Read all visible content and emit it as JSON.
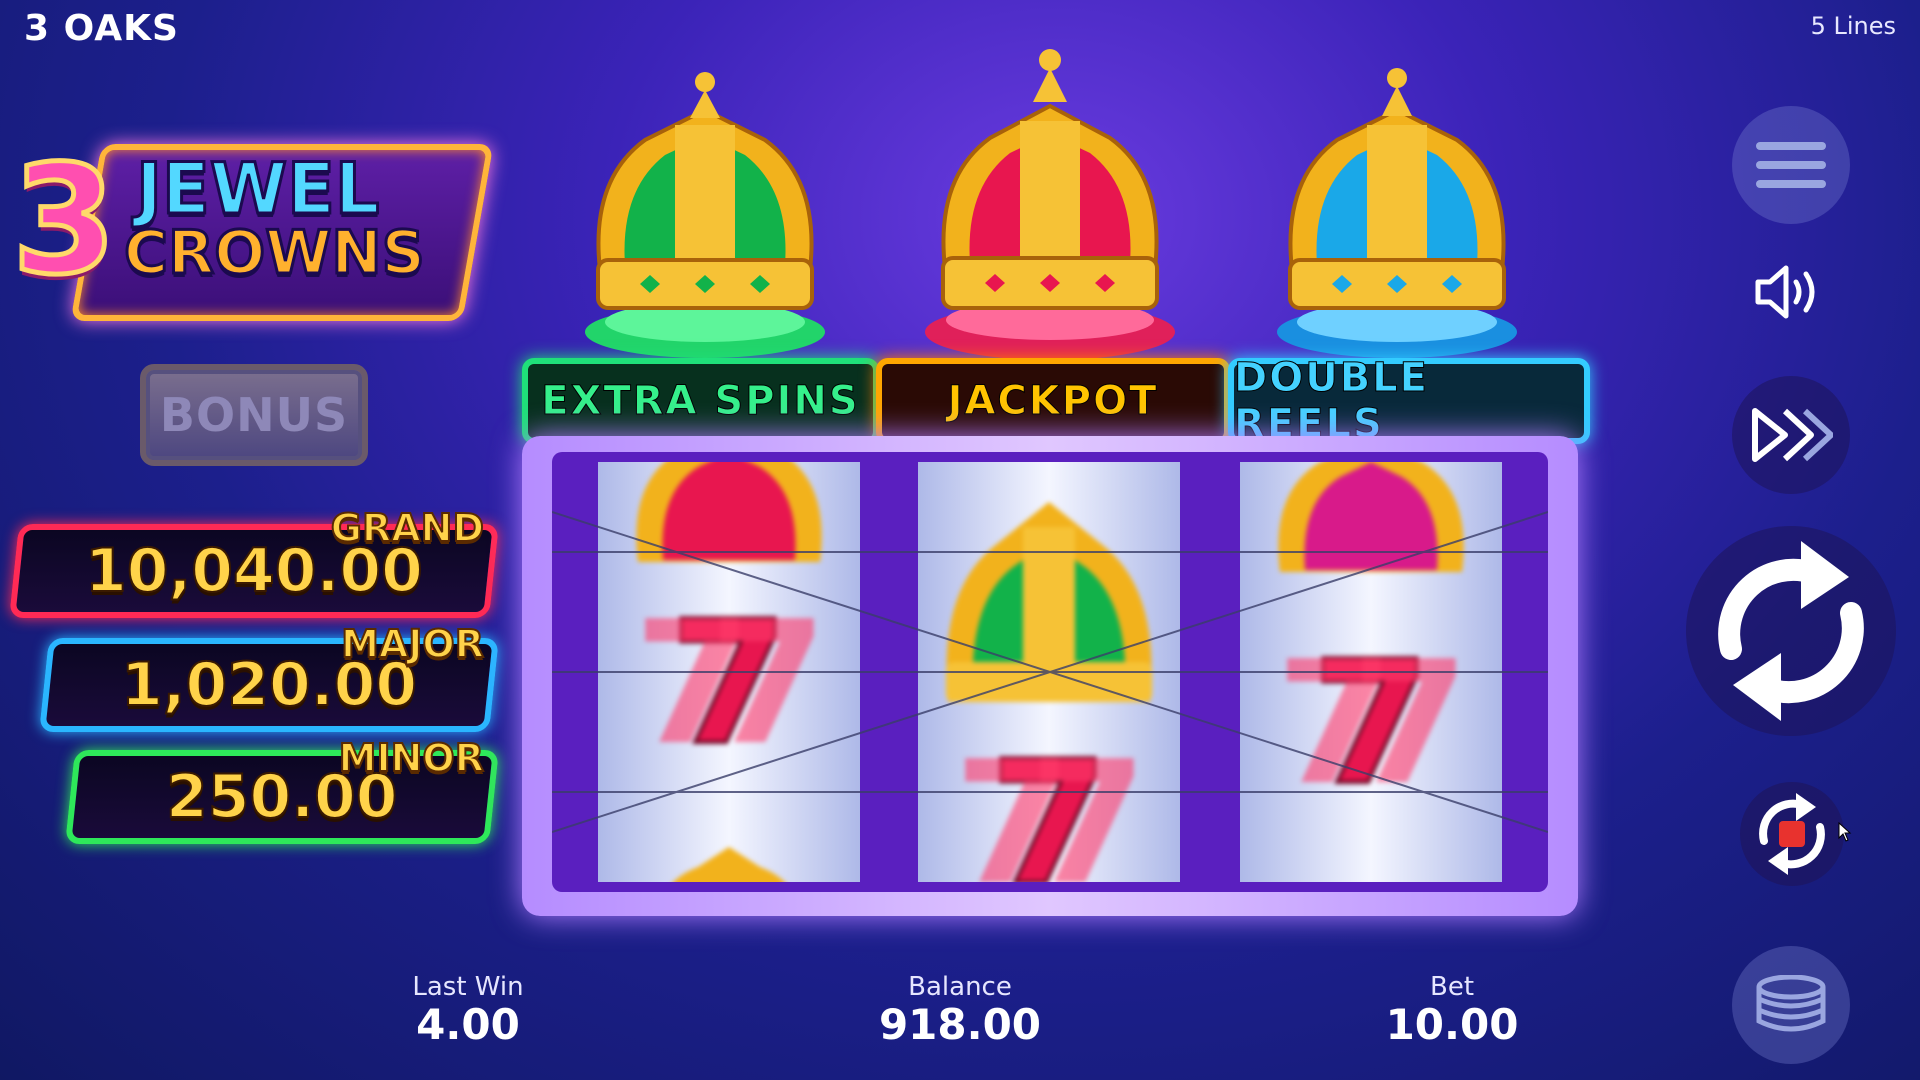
{
  "header": {
    "brand": "3 OAKS",
    "lines": "5 Lines"
  },
  "logo": {
    "number": "3",
    "line1": "JEWEL",
    "line2": "CROWNS"
  },
  "bonus": {
    "label": "BONUS"
  },
  "jackpots": {
    "grand": {
      "label": "GRAND",
      "value": "10,040.00",
      "color": "#ff2a55"
    },
    "major": {
      "label": "MAJOR",
      "value": "1,020.00",
      "color": "#2ab6ff"
    },
    "minor": {
      "label": "MINOR",
      "value": "250.00",
      "color": "#2ee85a"
    }
  },
  "features": {
    "extra_spins": {
      "label": "EXTRA SPINS",
      "crown_color": "#12b24a"
    },
    "jackpot": {
      "label": "JACKPOT",
      "crown_color": "#e8164f"
    },
    "double_reels": {
      "label": "DOUBLE REELS",
      "crown_color": "#1aa8e8"
    }
  },
  "reels": [
    {
      "symbols": [
        "crown-red",
        "seven",
        "crown-gold"
      ]
    },
    {
      "symbols": [
        "crown-green",
        "seven"
      ]
    },
    {
      "symbols": [
        "crown-red",
        "seven"
      ]
    }
  ],
  "info": {
    "last_win": {
      "label": "Last Win",
      "value": "4.00"
    },
    "balance": {
      "label": "Balance",
      "value": "918.00"
    },
    "bet": {
      "label": "Bet",
      "value": "10.00"
    }
  },
  "controls": {
    "menu": "menu-icon",
    "sound": "speaker-icon",
    "turbo": "fast-forward-icon",
    "spin": "spin-icon",
    "autoplay": "autoplay-stop-icon",
    "bet": "coins-icon"
  }
}
